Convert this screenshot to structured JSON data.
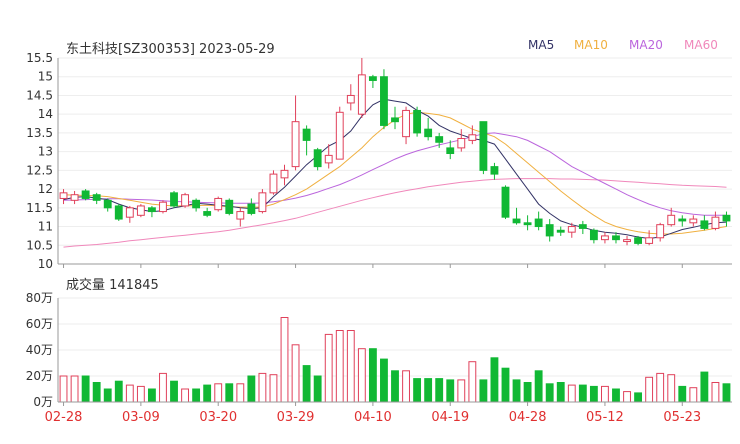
{
  "header": {
    "title": "东土科技[SZ300353] 2023-05-29",
    "ma_labels": [
      "MA5",
      "MA10",
      "MA20",
      "MA60"
    ],
    "volume_label": "成交量 141845"
  },
  "colors": {
    "up": "#e0405a",
    "down": "#10b834",
    "ma5": "#333366",
    "ma10": "#f0b040",
    "ma20": "#bb66dd",
    "ma60": "#f088bb",
    "axis": "#999999",
    "grid": "#eeeeee",
    "date_label": "#e03030"
  },
  "chart_data": [
    {
      "type": "candlestick",
      "title": "东土科技[SZ300353] 2023-05-29",
      "ylim": [
        10,
        15.5
      ],
      "y_ticks": [
        "10",
        "10.5",
        "11",
        "11.5",
        "12",
        "12.5",
        "13",
        "13.5",
        "14",
        "14.5",
        "15",
        "15.5"
      ],
      "x_ticks": [
        "02-28",
        "03-09",
        "03-20",
        "03-29",
        "04-10",
        "04-19",
        "04-28",
        "05-12",
        "05-23"
      ],
      "legend": [
        "MA5",
        "MA10",
        "MA20",
        "MA60"
      ],
      "legend_position": "top-right",
      "dates": [
        "02-28",
        "03-01",
        "03-02",
        "03-03",
        "03-06",
        "03-07",
        "03-08",
        "03-09",
        "03-10",
        "03-13",
        "03-14",
        "03-15",
        "03-16",
        "03-17",
        "03-20",
        "03-21",
        "03-22",
        "03-23",
        "03-24",
        "03-27",
        "03-28",
        "03-29",
        "03-30",
        "03-31",
        "04-03",
        "04-04",
        "04-06",
        "04-07",
        "04-10",
        "04-11",
        "04-12",
        "04-13",
        "04-14",
        "04-17",
        "04-18",
        "04-19",
        "04-20",
        "04-21",
        "04-24",
        "04-25",
        "04-26",
        "04-27",
        "04-28",
        "05-04",
        "05-05",
        "05-08",
        "05-09",
        "05-10",
        "05-11",
        "05-12",
        "05-15",
        "05-16",
        "05-17",
        "05-18",
        "05-19",
        "05-22",
        "05-23",
        "05-24",
        "05-25",
        "05-26",
        "05-29"
      ],
      "candles": [
        [
          11.75,
          11.9,
          12.0,
          11.6
        ],
        [
          11.7,
          11.85,
          11.95,
          11.6
        ],
        [
          11.95,
          11.75,
          12.0,
          11.7
        ],
        [
          11.85,
          11.7,
          11.9,
          11.6
        ],
        [
          11.7,
          11.5,
          11.75,
          11.4
        ],
        [
          11.55,
          11.2,
          11.6,
          11.15
        ],
        [
          11.25,
          11.5,
          11.55,
          11.1
        ],
        [
          11.3,
          11.55,
          11.6,
          11.25
        ],
        [
          11.5,
          11.4,
          11.55,
          11.25
        ],
        [
          11.4,
          11.65,
          11.7,
          11.35
        ],
        [
          11.9,
          11.55,
          11.95,
          11.5
        ],
        [
          11.55,
          11.85,
          11.9,
          11.5
        ],
        [
          11.7,
          11.5,
          11.75,
          11.4
        ],
        [
          11.4,
          11.3,
          11.5,
          11.25
        ],
        [
          11.45,
          11.75,
          11.8,
          11.4
        ],
        [
          11.7,
          11.35,
          11.75,
          11.3
        ],
        [
          11.2,
          11.4,
          11.5,
          11.0
        ],
        [
          11.6,
          11.35,
          11.75,
          11.3
        ],
        [
          11.4,
          11.9,
          12.0,
          11.35
        ],
        [
          11.9,
          12.4,
          12.5,
          11.85
        ],
        [
          12.3,
          12.5,
          12.65,
          12.1
        ],
        [
          12.6,
          13.8,
          14.5,
          12.5
        ],
        [
          13.6,
          13.3,
          13.7,
          12.9
        ],
        [
          13.05,
          12.6,
          13.1,
          12.5
        ],
        [
          12.7,
          12.9,
          13.2,
          12.55
        ],
        [
          12.8,
          14.05,
          14.2,
          12.8
        ],
        [
          14.3,
          14.5,
          14.8,
          14.1
        ],
        [
          14.0,
          15.05,
          15.5,
          13.9
        ],
        [
          15.0,
          14.9,
          15.05,
          14.7
        ],
        [
          15.0,
          13.7,
          15.2,
          13.6
        ],
        [
          13.9,
          13.8,
          14.2,
          13.6
        ],
        [
          13.4,
          14.1,
          14.2,
          13.2
        ],
        [
          14.1,
          13.5,
          14.2,
          13.4
        ],
        [
          13.6,
          13.4,
          13.9,
          13.3
        ],
        [
          13.4,
          13.25,
          13.5,
          13.1
        ],
        [
          13.1,
          12.95,
          13.3,
          12.8
        ],
        [
          13.1,
          13.35,
          13.6,
          13.0
        ],
        [
          13.3,
          13.45,
          13.7,
          13.2
        ],
        [
          13.8,
          12.5,
          13.8,
          12.4
        ],
        [
          12.6,
          12.4,
          12.7,
          12.25
        ],
        [
          12.05,
          11.25,
          12.1,
          11.2
        ],
        [
          11.2,
          11.1,
          11.5,
          11.05
        ],
        [
          11.1,
          11.05,
          11.3,
          10.9
        ],
        [
          11.2,
          11.0,
          11.4,
          10.9
        ],
        [
          11.05,
          10.75,
          11.2,
          10.6
        ],
        [
          10.9,
          10.85,
          11.0,
          10.75
        ],
        [
          10.85,
          11.0,
          11.1,
          10.7
        ],
        [
          11.05,
          10.95,
          11.15,
          10.8
        ],
        [
          10.9,
          10.65,
          10.95,
          10.55
        ],
        [
          10.65,
          10.75,
          10.85,
          10.55
        ],
        [
          10.75,
          10.65,
          10.85,
          10.55
        ],
        [
          10.6,
          10.65,
          10.75,
          10.5
        ],
        [
          10.7,
          10.55,
          10.75,
          10.5
        ],
        [
          10.55,
          10.7,
          10.9,
          10.5
        ],
        [
          10.7,
          11.05,
          11.1,
          10.6
        ],
        [
          11.05,
          11.3,
          11.5,
          11.0
        ],
        [
          11.2,
          11.15,
          11.3,
          11.0
        ],
        [
          11.1,
          11.2,
          11.3,
          11.0
        ],
        [
          11.15,
          10.95,
          11.3,
          10.9
        ],
        [
          10.95,
          11.25,
          11.4,
          10.9
        ],
        [
          11.3,
          11.15,
          11.4,
          11.0
        ]
      ],
      "ma5": [
        11.72,
        11.78,
        11.8,
        11.76,
        11.72,
        11.6,
        11.5,
        11.45,
        11.4,
        11.42,
        11.5,
        11.55,
        11.62,
        11.6,
        11.57,
        11.54,
        11.5,
        11.48,
        11.5,
        11.8,
        12.05,
        12.35,
        12.65,
        12.9,
        13.15,
        13.3,
        13.55,
        13.95,
        14.25,
        14.4,
        14.35,
        14.3,
        14.1,
        13.95,
        13.7,
        13.55,
        13.45,
        13.35,
        13.3,
        13.2,
        12.8,
        12.4,
        12.0,
        11.6,
        11.35,
        11.15,
        11.05,
        10.98,
        10.9,
        10.85,
        10.82,
        10.78,
        10.72,
        10.68,
        10.72,
        10.82,
        10.92,
        10.98,
        11.05,
        11.1,
        11.12
      ],
      "ma10": [
        11.85,
        11.84,
        11.83,
        11.82,
        11.8,
        11.75,
        11.7,
        11.65,
        11.6,
        11.57,
        11.55,
        11.55,
        11.56,
        11.57,
        11.55,
        11.53,
        11.52,
        11.52,
        11.52,
        11.6,
        11.72,
        11.85,
        12.0,
        12.2,
        12.4,
        12.6,
        12.85,
        13.1,
        13.4,
        13.65,
        13.85,
        14.0,
        14.05,
        14.02,
        13.98,
        13.9,
        13.75,
        13.6,
        13.5,
        13.4,
        13.2,
        12.95,
        12.7,
        12.45,
        12.2,
        11.95,
        11.72,
        11.5,
        11.3,
        11.12,
        11.0,
        10.92,
        10.86,
        10.82,
        10.8,
        10.8,
        10.82,
        10.86,
        10.9,
        10.95,
        11.0
      ],
      "ma20": [
        11.7,
        11.71,
        11.72,
        11.73,
        11.74,
        11.74,
        11.73,
        11.72,
        11.71,
        11.69,
        11.67,
        11.66,
        11.65,
        11.64,
        11.63,
        11.62,
        11.62,
        11.62,
        11.63,
        11.66,
        11.7,
        11.76,
        11.83,
        11.92,
        12.02,
        12.12,
        12.24,
        12.38,
        12.52,
        12.66,
        12.8,
        12.92,
        13.02,
        13.1,
        13.18,
        13.25,
        13.32,
        13.4,
        13.48,
        13.5,
        13.45,
        13.4,
        13.3,
        13.15,
        13.0,
        12.8,
        12.6,
        12.45,
        12.3,
        12.15,
        12.0,
        11.85,
        11.72,
        11.6,
        11.5,
        11.42,
        11.37,
        11.33,
        11.3,
        11.3,
        11.3
      ],
      "ma60": [
        10.45,
        10.48,
        10.5,
        10.52,
        10.55,
        10.58,
        10.62,
        10.65,
        10.68,
        10.71,
        10.74,
        10.77,
        10.8,
        10.83,
        10.86,
        10.9,
        10.95,
        11.0,
        11.05,
        11.1,
        11.16,
        11.22,
        11.3,
        11.38,
        11.46,
        11.54,
        11.62,
        11.7,
        11.77,
        11.84,
        11.9,
        11.96,
        12.01,
        12.06,
        12.1,
        12.14,
        12.18,
        12.21,
        12.24,
        12.26,
        12.27,
        12.28,
        12.28,
        12.28,
        12.28,
        12.27,
        12.27,
        12.26,
        12.25,
        12.24,
        12.22,
        12.2,
        12.18,
        12.16,
        12.14,
        12.12,
        12.1,
        12.09,
        12.08,
        12.07,
        12.05
      ]
    },
    {
      "type": "bar",
      "title": "成交量 141845",
      "ylim": [
        0,
        80
      ],
      "y_ticks": [
        "0万",
        "20万",
        "40万",
        "60万",
        "80万"
      ],
      "x_ticks": [
        "02-28",
        "03-09",
        "03-20",
        "03-29",
        "04-10",
        "04-19",
        "04-28",
        "05-12",
        "05-23"
      ],
      "values": [
        20,
        20,
        20,
        15,
        10,
        16,
        13,
        12,
        10,
        22,
        16,
        10,
        10,
        13,
        14,
        14,
        14,
        20,
        22,
        21,
        65,
        44,
        28,
        20,
        52,
        55,
        55,
        41,
        41,
        33,
        24,
        24,
        18,
        18,
        18,
        17,
        17,
        31,
        17,
        34,
        26,
        17,
        15,
        24,
        14,
        15,
        13,
        13,
        12,
        12,
        10,
        8,
        7,
        19,
        22,
        21,
        12,
        11,
        23,
        15,
        14
      ]
    }
  ]
}
